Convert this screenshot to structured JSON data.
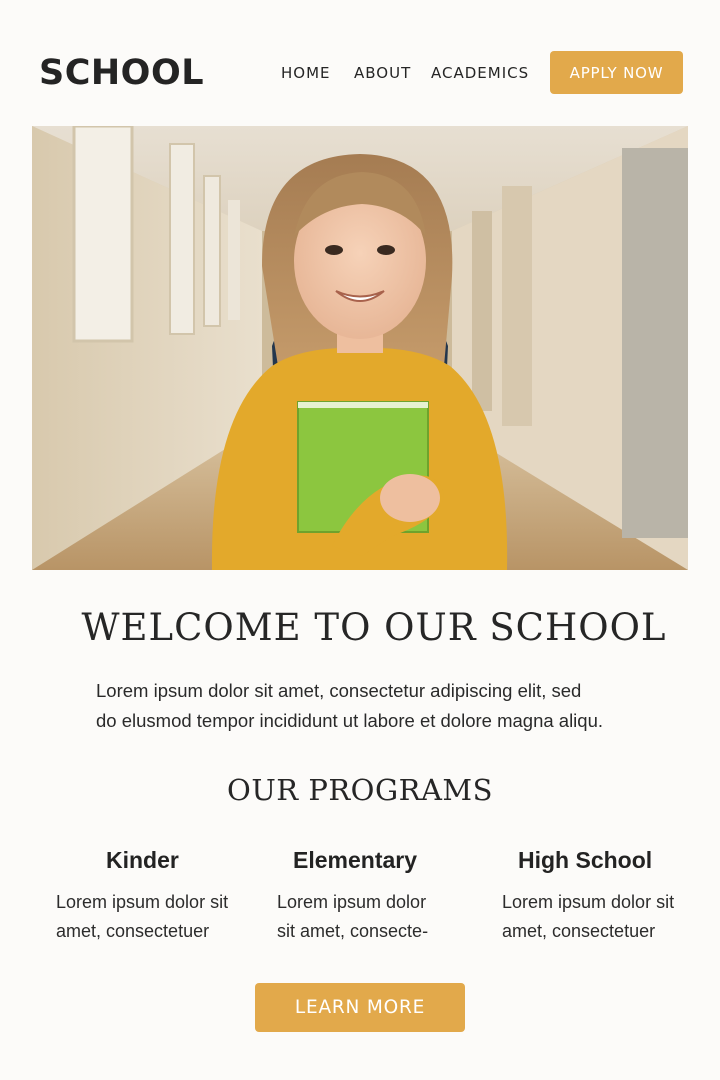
{
  "header": {
    "logo": "SCHOOL",
    "nav": [
      "HOME",
      "ABOUT",
      "ACADEMICS"
    ],
    "apply_label": "APPLY NOW"
  },
  "hero": {
    "colors": {
      "sweater": "#e3a92b",
      "book": "#8cc63f",
      "wall": "#e6dccb",
      "floor": "#c7ab7f"
    }
  },
  "welcome": {
    "title": "WELCOME TO OUR SCHOOL",
    "text_line1": "Lorem ipsum dolor sit amet, consectetur adipiscing elit, sed",
    "text_line2": "do elusmod tempor incididunt ut labore et dolore magna aliqu."
  },
  "programs": {
    "title": "OUR PROGRAMS",
    "items": [
      {
        "name": "Kinder",
        "line1": "Lorem ipsum dolor sit",
        "line2": "amet, consectetuer"
      },
      {
        "name": "Elementary",
        "line1": "Lorem ipsum dolor",
        "line2": "sit amet, consecte-"
      },
      {
        "name": "High School",
        "line1": "Lorem ipsum dolor sit",
        "line2": "amet, consectetuer"
      }
    ],
    "learn_label": "LEARN MORE"
  },
  "theme": {
    "accent": "#e2a94b",
    "text": "#242424",
    "background": "#fcfbf9"
  }
}
